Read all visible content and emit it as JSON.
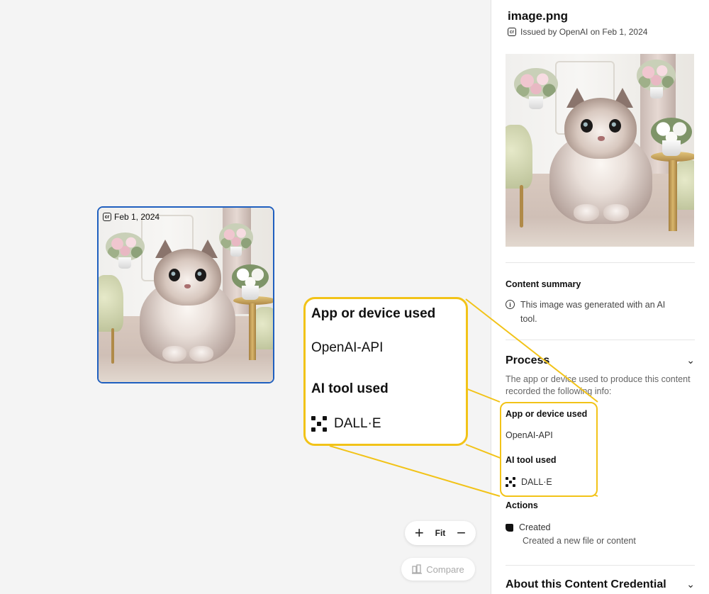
{
  "asset": {
    "date_badge": "Feb 1, 2024"
  },
  "zoom": {
    "zoom_in": "+",
    "fit": "Fit",
    "zoom_out": "−"
  },
  "compare": {
    "label": "Compare"
  },
  "panel": {
    "file_name": "image.png",
    "issued_line": "Issued by OpenAI on Feb 1, 2024",
    "content_summary": {
      "heading": "Content summary",
      "text": "This image was generated with an AI tool."
    },
    "process": {
      "heading": "Process",
      "description": "The app or device used to produce this content recorded the following info:",
      "app_label": "App or device used",
      "app_value": "OpenAI-API",
      "ai_tool_label": "AI tool used",
      "ai_tool_value": "DALL·E",
      "actions_label": "Actions",
      "action_name": "Created",
      "action_desc": "Created a new file or content"
    },
    "about": {
      "heading": "About this Content Credential"
    }
  },
  "callout": {
    "app_label": "App or device used",
    "app_value": "OpenAI-API",
    "ai_tool_label": "AI tool used",
    "ai_tool_value": "DALL·E",
    "border_color": "#f2c318"
  },
  "icons": {
    "credential": "cr-icon",
    "info": "info-icon",
    "dalle": "dalle-icon",
    "created": "created-icon",
    "compare": "compare-icon",
    "chevron": "chevron-down-icon"
  }
}
